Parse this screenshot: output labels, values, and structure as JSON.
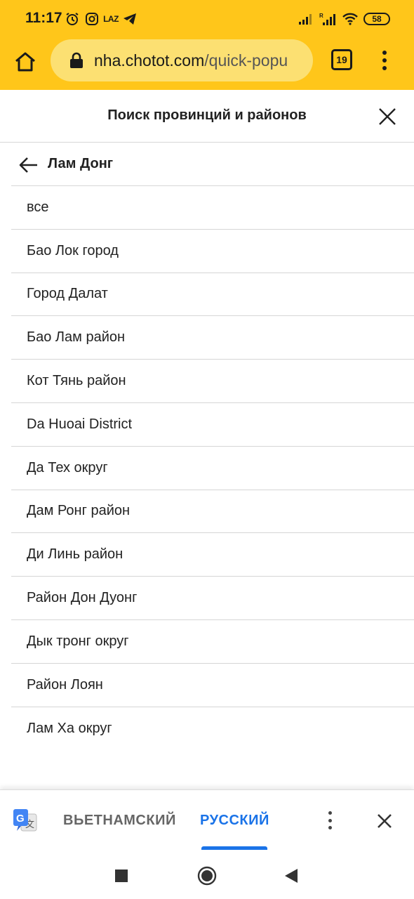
{
  "status_bar": {
    "time": "11:17",
    "battery": "58",
    "laz_label": "LAZ",
    "icons": [
      "alarm-icon",
      "instagram-icon",
      "laz-icon",
      "telegram-icon",
      "signal-icon",
      "signal-roaming-icon",
      "wifi-icon",
      "battery-icon"
    ]
  },
  "browser": {
    "url_domain": "nha.chotot.com",
    "url_path": "/quick-popu",
    "tab_count": "19",
    "accent_color": "#FFC61A"
  },
  "page": {
    "title": "Поиск провинций и районов",
    "province": "Лам Донг",
    "districts": [
      "все",
      "Бао Лок город",
      "Город Далат",
      "Бао Лам район",
      "Кот Тянь район",
      "Da Huoai District",
      "Да Тех округ",
      "Дам Ронг район",
      "Ди Линь район",
      "Район Дон Дуонг",
      "Дык тронг округ",
      "Район Лоян",
      "Лам Ха округ"
    ]
  },
  "translate_bar": {
    "source_lang": "ВЬЕТНАМСКИЙ",
    "target_lang": "РУССКИЙ",
    "active_color": "#1A73E8"
  }
}
